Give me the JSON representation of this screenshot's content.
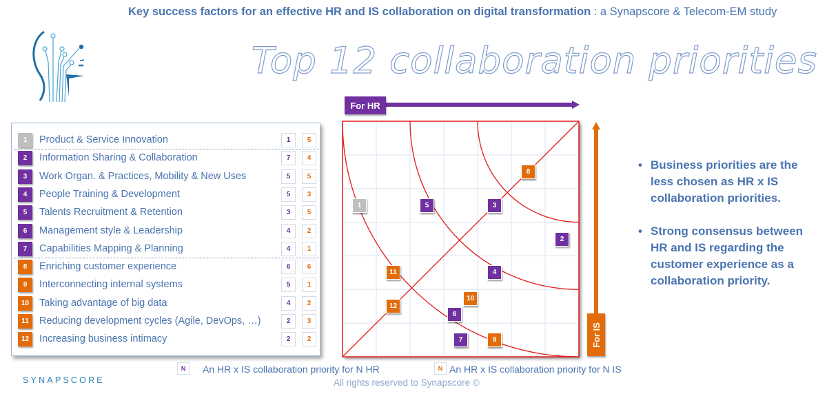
{
  "header": {
    "subtitle_bold": "Key success factors for an effective HR and IS collaboration on digital transformation",
    "subtitle_rest": " : a Synapscore & Telecom-EM study",
    "title": "Top 12 collaboration priorities"
  },
  "brand": {
    "name": "SYNAPSCORE",
    "logo_icon": "synapse-head-logo"
  },
  "colors": {
    "hr_purple": "#7030a0",
    "is_orange": "#e36c0a",
    "business_gray": "#bfbfbf",
    "text_blue": "#4a74b0",
    "curve_red": "#e31b1b",
    "grid": "#dbe5f1"
  },
  "priorities": [
    {
      "id": "1",
      "label": "Product & Service Innovation",
      "hr": "1",
      "is": "5",
      "group": "business"
    },
    {
      "id": "2",
      "label": "Information Sharing & Collaboration",
      "hr": "7",
      "is": "4",
      "group": "hr"
    },
    {
      "id": "3",
      "label": "Work Organ. & Practices, Mobility & New Uses",
      "hr": "5",
      "is": "5",
      "group": "hr"
    },
    {
      "id": "4",
      "label": "People Training & Development",
      "hr": "5",
      "is": "3",
      "group": "hr"
    },
    {
      "id": "5",
      "label": "Talents Recruitment & Retention",
      "hr": "3",
      "is": "5",
      "group": "hr"
    },
    {
      "id": "6",
      "label": "Management style & Leadership",
      "hr": "4",
      "is": "2",
      "group": "hr"
    },
    {
      "id": "7",
      "label": "Capabilities Mapping & Planning",
      "hr": "4",
      "is": "1",
      "group": "hr"
    },
    {
      "id": "8",
      "label": "Enriching customer experience",
      "hr": "6",
      "is": "6",
      "group": "is"
    },
    {
      "id": "9",
      "label": "Interconnecting internal systems",
      "hr": "5",
      "is": "1",
      "group": "is"
    },
    {
      "id": "10",
      "label": "Taking advantage of big data",
      "hr": "4",
      "is": "2",
      "group": "is"
    },
    {
      "id": "11",
      "label": "Reducing development cycles (Agile, DevOps, …)",
      "hr": "2",
      "is": "3",
      "group": "is"
    },
    {
      "id": "12",
      "label": "Increasing business intimacy",
      "hr": "2",
      "is": "2",
      "group": "is"
    }
  ],
  "chart_data": {
    "type": "scatter",
    "title": "Top 12 collaboration priorities",
    "xlabel": "For HR",
    "ylabel": "For IS",
    "xlim": [
      0,
      7
    ],
    "ylim": [
      0,
      7
    ],
    "grid": true,
    "gridlines": 7,
    "points": [
      {
        "label": "1",
        "x": 1,
        "y": 5,
        "group": "business"
      },
      {
        "label": "2",
        "x": 7,
        "y": 4,
        "group": "hr"
      },
      {
        "label": "3",
        "x": 5,
        "y": 5,
        "group": "hr"
      },
      {
        "label": "4",
        "x": 5,
        "y": 3,
        "group": "hr"
      },
      {
        "label": "5",
        "x": 3,
        "y": 5,
        "group": "hr"
      },
      {
        "label": "6",
        "x": 4,
        "y": 2,
        "group": "hr"
      },
      {
        "label": "7",
        "x": 4,
        "y": 1,
        "group": "hr"
      },
      {
        "label": "8",
        "x": 6,
        "y": 6,
        "group": "is"
      },
      {
        "label": "9",
        "x": 5,
        "y": 1,
        "group": "is"
      },
      {
        "label": "10",
        "x": 4,
        "y": 2,
        "group": "is"
      },
      {
        "label": "11",
        "x": 2,
        "y": 3,
        "group": "is"
      },
      {
        "label": "12",
        "x": 2,
        "y": 2,
        "group": "is"
      }
    ],
    "reference_curves": {
      "diagonal": "equal HR and IS scores",
      "arcs_from_top_right_radius_in_units": [
        7,
        5,
        3
      ]
    }
  },
  "bullets": [
    "Business priorities are the less chosen as HR x IS collaboration priorities.",
    "Strong consensus between HR and IS regarding the customer experience as a collaboration priority."
  ],
  "bullet_char": "•",
  "legend": {
    "hr": {
      "marker": "N",
      "text": "An HR x IS collaboration priority for N HR"
    },
    "is": {
      "marker": "N",
      "text": "An HR x IS collaboration priority for N IS"
    }
  },
  "footer": {
    "copyright": "All rights reserved to Synapscore ©"
  }
}
